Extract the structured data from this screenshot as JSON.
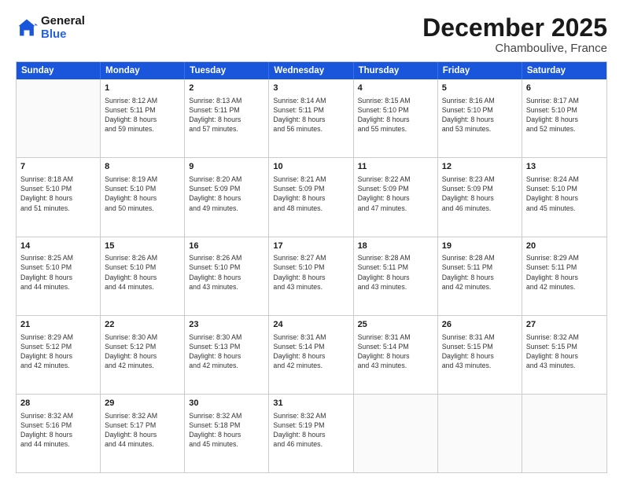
{
  "logo": {
    "line1": "General",
    "line2": "Blue"
  },
  "title": "December 2025",
  "subtitle": "Chamboulive, France",
  "header": {
    "days": [
      "Sunday",
      "Monday",
      "Tuesday",
      "Wednesday",
      "Thursday",
      "Friday",
      "Saturday"
    ]
  },
  "weeks": [
    [
      {
        "day": "",
        "info": ""
      },
      {
        "day": "1",
        "info": "Sunrise: 8:12 AM\nSunset: 5:11 PM\nDaylight: 8 hours\nand 59 minutes."
      },
      {
        "day": "2",
        "info": "Sunrise: 8:13 AM\nSunset: 5:11 PM\nDaylight: 8 hours\nand 57 minutes."
      },
      {
        "day": "3",
        "info": "Sunrise: 8:14 AM\nSunset: 5:11 PM\nDaylight: 8 hours\nand 56 minutes."
      },
      {
        "day": "4",
        "info": "Sunrise: 8:15 AM\nSunset: 5:10 PM\nDaylight: 8 hours\nand 55 minutes."
      },
      {
        "day": "5",
        "info": "Sunrise: 8:16 AM\nSunset: 5:10 PM\nDaylight: 8 hours\nand 53 minutes."
      },
      {
        "day": "6",
        "info": "Sunrise: 8:17 AM\nSunset: 5:10 PM\nDaylight: 8 hours\nand 52 minutes."
      }
    ],
    [
      {
        "day": "7",
        "info": "Sunrise: 8:18 AM\nSunset: 5:10 PM\nDaylight: 8 hours\nand 51 minutes."
      },
      {
        "day": "8",
        "info": "Sunrise: 8:19 AM\nSunset: 5:10 PM\nDaylight: 8 hours\nand 50 minutes."
      },
      {
        "day": "9",
        "info": "Sunrise: 8:20 AM\nSunset: 5:09 PM\nDaylight: 8 hours\nand 49 minutes."
      },
      {
        "day": "10",
        "info": "Sunrise: 8:21 AM\nSunset: 5:09 PM\nDaylight: 8 hours\nand 48 minutes."
      },
      {
        "day": "11",
        "info": "Sunrise: 8:22 AM\nSunset: 5:09 PM\nDaylight: 8 hours\nand 47 minutes."
      },
      {
        "day": "12",
        "info": "Sunrise: 8:23 AM\nSunset: 5:09 PM\nDaylight: 8 hours\nand 46 minutes."
      },
      {
        "day": "13",
        "info": "Sunrise: 8:24 AM\nSunset: 5:10 PM\nDaylight: 8 hours\nand 45 minutes."
      }
    ],
    [
      {
        "day": "14",
        "info": "Sunrise: 8:25 AM\nSunset: 5:10 PM\nDaylight: 8 hours\nand 44 minutes."
      },
      {
        "day": "15",
        "info": "Sunrise: 8:26 AM\nSunset: 5:10 PM\nDaylight: 8 hours\nand 44 minutes."
      },
      {
        "day": "16",
        "info": "Sunrise: 8:26 AM\nSunset: 5:10 PM\nDaylight: 8 hours\nand 43 minutes."
      },
      {
        "day": "17",
        "info": "Sunrise: 8:27 AM\nSunset: 5:10 PM\nDaylight: 8 hours\nand 43 minutes."
      },
      {
        "day": "18",
        "info": "Sunrise: 8:28 AM\nSunset: 5:11 PM\nDaylight: 8 hours\nand 43 minutes."
      },
      {
        "day": "19",
        "info": "Sunrise: 8:28 AM\nSunset: 5:11 PM\nDaylight: 8 hours\nand 42 minutes."
      },
      {
        "day": "20",
        "info": "Sunrise: 8:29 AM\nSunset: 5:11 PM\nDaylight: 8 hours\nand 42 minutes."
      }
    ],
    [
      {
        "day": "21",
        "info": "Sunrise: 8:29 AM\nSunset: 5:12 PM\nDaylight: 8 hours\nand 42 minutes."
      },
      {
        "day": "22",
        "info": "Sunrise: 8:30 AM\nSunset: 5:12 PM\nDaylight: 8 hours\nand 42 minutes."
      },
      {
        "day": "23",
        "info": "Sunrise: 8:30 AM\nSunset: 5:13 PM\nDaylight: 8 hours\nand 42 minutes."
      },
      {
        "day": "24",
        "info": "Sunrise: 8:31 AM\nSunset: 5:14 PM\nDaylight: 8 hours\nand 42 minutes."
      },
      {
        "day": "25",
        "info": "Sunrise: 8:31 AM\nSunset: 5:14 PM\nDaylight: 8 hours\nand 43 minutes."
      },
      {
        "day": "26",
        "info": "Sunrise: 8:31 AM\nSunset: 5:15 PM\nDaylight: 8 hours\nand 43 minutes."
      },
      {
        "day": "27",
        "info": "Sunrise: 8:32 AM\nSunset: 5:15 PM\nDaylight: 8 hours\nand 43 minutes."
      }
    ],
    [
      {
        "day": "28",
        "info": "Sunrise: 8:32 AM\nSunset: 5:16 PM\nDaylight: 8 hours\nand 44 minutes."
      },
      {
        "day": "29",
        "info": "Sunrise: 8:32 AM\nSunset: 5:17 PM\nDaylight: 8 hours\nand 44 minutes."
      },
      {
        "day": "30",
        "info": "Sunrise: 8:32 AM\nSunset: 5:18 PM\nDaylight: 8 hours\nand 45 minutes."
      },
      {
        "day": "31",
        "info": "Sunrise: 8:32 AM\nSunset: 5:19 PM\nDaylight: 8 hours\nand 46 minutes."
      },
      {
        "day": "",
        "info": ""
      },
      {
        "day": "",
        "info": ""
      },
      {
        "day": "",
        "info": ""
      }
    ]
  ]
}
